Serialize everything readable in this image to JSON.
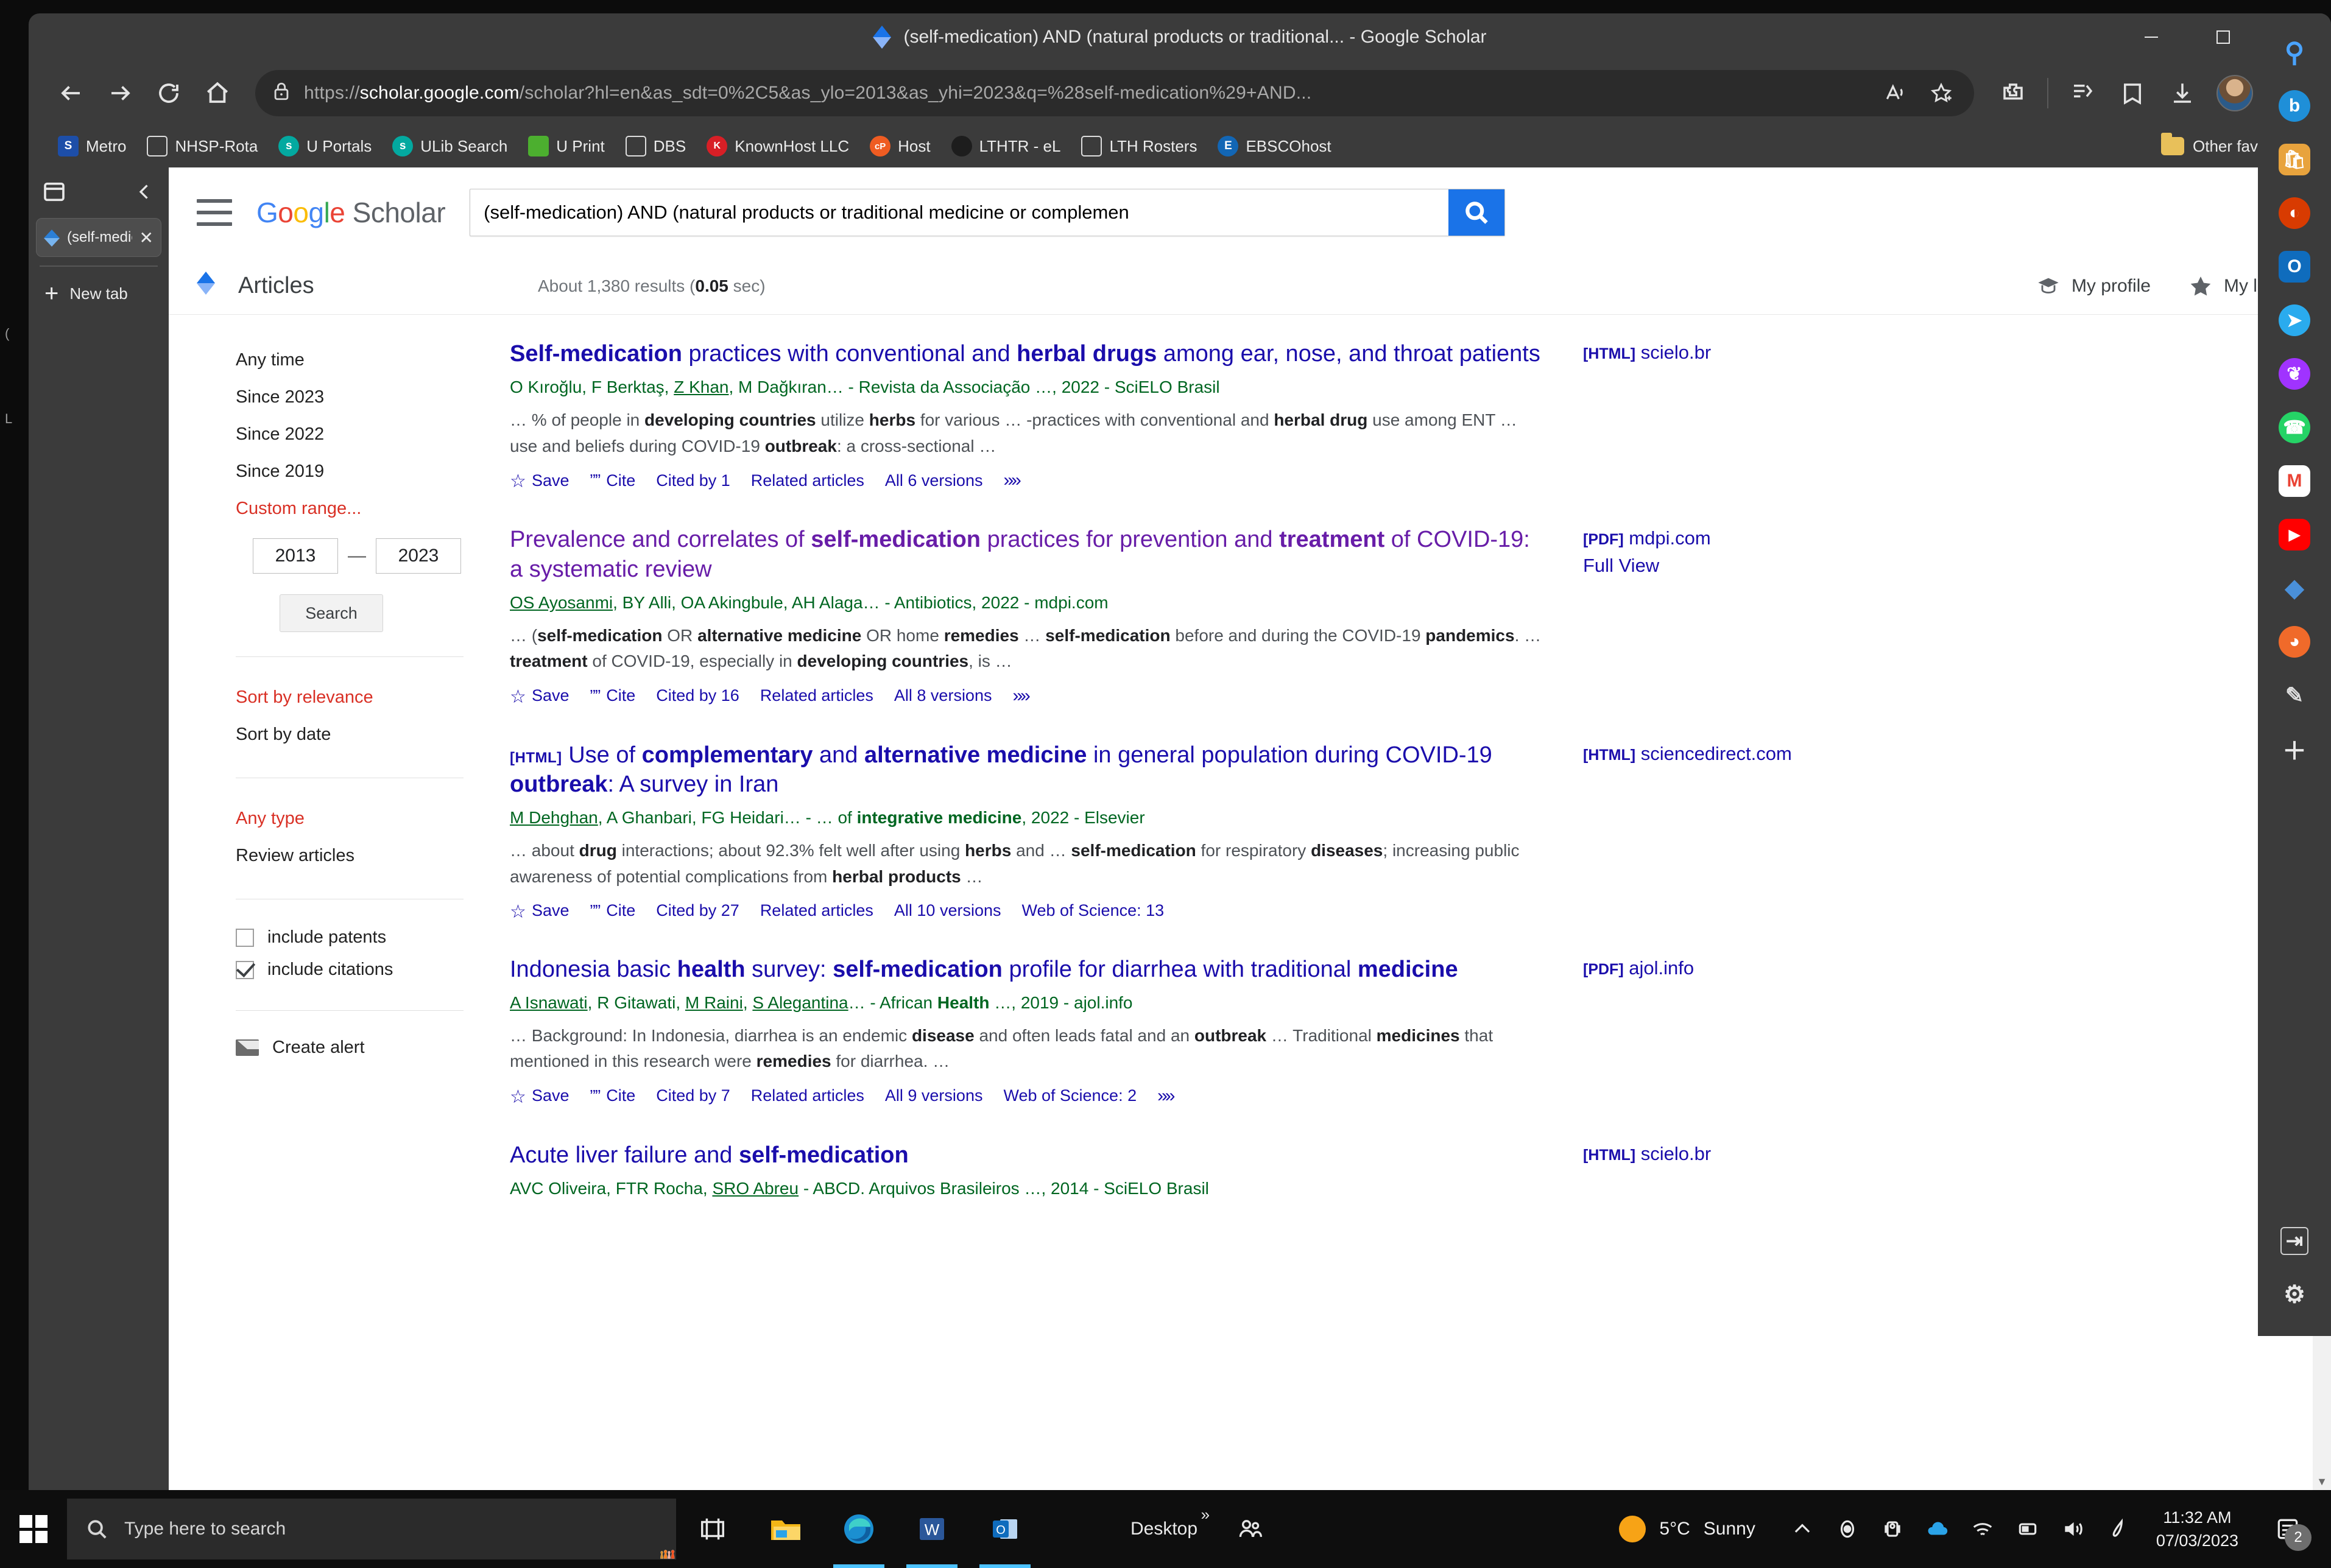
{
  "window": {
    "title": "(self-medication) AND (natural products or traditional... - Google Scholar",
    "minimize": "—",
    "maximize": "☐",
    "close": "✕"
  },
  "navbar": {
    "url_scheme": "https://",
    "url_host": "scholar.google.com",
    "url_path": "/scholar?hl=en&as_sdt=0%2C5&as_ylo=2013&as_yhi=2023&q=%28self-medication%29+AND...",
    "back_icon": "back-arrow-icon",
    "forward_icon": "forward-arrow-icon",
    "refresh_icon": "refresh-icon",
    "home_icon": "home-icon",
    "lock_icon": "lock-icon",
    "read_aloud_icon": "read-aloud-icon",
    "favorite_icon": "add-favorite-icon",
    "extensions_icon": "extensions-icon",
    "collections_icon": "collections-icon",
    "favorites_icon": "favorites-icon",
    "downloads_icon": "downloads-icon",
    "profile_icon": "profile-avatar",
    "settings_more": "•••"
  },
  "bookmarks": {
    "items": [
      {
        "label": "Metro",
        "icon": "metro-icon",
        "color": "#1d4ea8",
        "glyph": "S"
      },
      {
        "label": "NHSP-Rota",
        "icon": "page-icon",
        "color": "transparent",
        "glyph": ""
      },
      {
        "label": "U Portals",
        "icon": "sharepoint-icon",
        "color": "#03a9a0",
        "glyph": "s"
      },
      {
        "label": "ULib Search",
        "icon": "sharepoint-icon",
        "color": "#03a9a0",
        "glyph": "s"
      },
      {
        "label": "U Print",
        "icon": "papercut-icon",
        "color": "#4caf2f",
        "glyph": ""
      },
      {
        "label": "DBS",
        "icon": "page-icon",
        "color": "transparent",
        "glyph": ""
      },
      {
        "label": "KnownHost LLC",
        "icon": "knownhost-icon",
        "color": "#d81f26",
        "glyph": "K"
      },
      {
        "label": "Host",
        "icon": "cpanel-icon",
        "color": "#ef5c22",
        "glyph": "cP"
      },
      {
        "label": "LTHTR - eL",
        "icon": "dark-circle-icon",
        "color": "#2a2a2a",
        "glyph": ""
      },
      {
        "label": "LTH Rosters",
        "icon": "page-icon",
        "color": "transparent",
        "glyph": ""
      },
      {
        "label": "EBSCOhost",
        "icon": "ebsco-icon",
        "color": "#1266b5",
        "glyph": "E"
      }
    ],
    "other_favourites": "Other favourites",
    "other_favourites_icon": "folder-icon"
  },
  "tabstrip": {
    "toggle_icon": "tab-pane-icon",
    "collapse_icon": "chevron-left-icon",
    "tab_title": "(self-medicat",
    "tab_favicon": "google-scholar-icon",
    "tab_close": "✕",
    "new_tab": "New tab",
    "new_tab_icon": "plus-icon"
  },
  "scholar": {
    "menu_icon": "hamburger-menu-icon",
    "logo": {
      "g1": "G",
      "o1": "o",
      "o2": "o",
      "g2": "g",
      "l": "l",
      "e": "e",
      "scholar": "Scholar"
    },
    "search_value": "(self-medication) AND (natural products or traditional medicine or complemen",
    "search_placeholder": "Search",
    "search_button_icon": "search-icon",
    "account_avatar": "account-avatar",
    "articles_label": "Articles",
    "articles_icon": "google-scholar-diamond-icon",
    "results_text_prefix": "About 1,380 results (",
    "results_time": "0.05",
    "results_text_suffix": " sec)",
    "my_profile": "My profile",
    "my_profile_icon": "graduation-cap-icon",
    "my_library": "My library",
    "my_library_icon": "star-icon"
  },
  "sidebar": {
    "time_filters": [
      {
        "label": "Any time",
        "state": "normal"
      },
      {
        "label": "Since 2023",
        "state": "normal"
      },
      {
        "label": "Since 2022",
        "state": "normal"
      },
      {
        "label": "Since 2019",
        "state": "normal"
      },
      {
        "label": "Custom range...",
        "state": "active"
      }
    ],
    "year_from": "2013",
    "year_to": "2023",
    "range_dash": "—",
    "search_button": "Search",
    "sort_filters": [
      {
        "label": "Sort by relevance",
        "state": "active"
      },
      {
        "label": "Sort by date",
        "state": "normal"
      }
    ],
    "type_filters": [
      {
        "label": "Any type",
        "state": "active"
      },
      {
        "label": "Review articles",
        "state": "normal"
      }
    ],
    "checkboxes": [
      {
        "label": "include patents",
        "checked": false
      },
      {
        "label": "include citations",
        "checked": true
      }
    ],
    "create_alert": "Create alert",
    "create_alert_icon": "envelope-icon"
  },
  "results": [
    {
      "tag": "",
      "title_parts": [
        {
          "t": "Self-medication",
          "b": true
        },
        {
          "t": " practices with conventional and ",
          "b": false
        },
        {
          "t": "herbal drugs",
          "b": true
        },
        {
          "t": " among ear, nose, and throat patients",
          "b": false
        }
      ],
      "title_plain": "Self-medication practices with conventional and herbal drugs among ear, nose, and throat patients",
      "visited": false,
      "authors": "O Kıroğlu, F Brktaş, Z Khan, M Dağkıran… - Revista da Associação …, 2022 - SciELO Brasil",
      "authors_parts": [
        {
          "t": "O Kıroğlu, F Berktaş, ",
          "u": false,
          "b": false
        },
        {
          "t": "Z Khan",
          "u": true,
          "b": false
        },
        {
          "t": ", M Dağkıran… - Revista da Associação …, 2022 - SciELO Brasil",
          "u": false,
          "b": false
        }
      ],
      "snippet_parts": [
        {
          "t": "… % of people in ",
          "b": false
        },
        {
          "t": "developing countries",
          "b": true
        },
        {
          "t": " utilize ",
          "b": false
        },
        {
          "t": "herbs",
          "b": true
        },
        {
          "t": " for various … -practices with conventional and ",
          "b": false
        },
        {
          "t": "herbal drug",
          "b": true
        },
        {
          "t": " use among ENT … use and beliefs during COVID-19 ",
          "b": false
        },
        {
          "t": "outbreak",
          "b": true
        },
        {
          "t": ": a cross-sectional …",
          "b": false
        }
      ],
      "links": [
        "Save",
        "Cite",
        "Cited by 1",
        "Related articles",
        "All 6 versions"
      ],
      "has_more_chevron": true,
      "side_tag": "[HTML]",
      "side_domain": "scielo.br",
      "side_extra": ""
    },
    {
      "tag": "",
      "title_parts": [
        {
          "t": "Prevalence and correlates of ",
          "b": false
        },
        {
          "t": "self-medication",
          "b": true
        },
        {
          "t": " practices for prevention and ",
          "b": false
        },
        {
          "t": "treatment",
          "b": true
        },
        {
          "t": " of COVID-19: a systematic review",
          "b": false
        }
      ],
      "title_plain": "Prevalence and correlates of self-medication practices for prevention and treatment of COVID-19: a systematic review",
      "visited": true,
      "authors_parts": [
        {
          "t": "OS Ayosanmi",
          "u": true,
          "b": false
        },
        {
          "t": ", BY Alli, OA Akingbule, AH Alaga… - Antibiotics, 2022 - mdpi.com",
          "u": false,
          "b": false
        }
      ],
      "snippet_parts": [
        {
          "t": "… (",
          "b": false
        },
        {
          "t": "self-medication",
          "b": true
        },
        {
          "t": " OR ",
          "b": false
        },
        {
          "t": "alternative medicine",
          "b": true
        },
        {
          "t": " OR home ",
          "b": false
        },
        {
          "t": "remedies",
          "b": true
        },
        {
          "t": " … ",
          "b": false
        },
        {
          "t": "self-medication",
          "b": true
        },
        {
          "t": " before and during the COVID-19 ",
          "b": false
        },
        {
          "t": "pandemics",
          "b": true
        },
        {
          "t": ". … ",
          "b": false
        },
        {
          "t": "treatment",
          "b": true
        },
        {
          "t": " of COVID-19, especially in ",
          "b": false
        },
        {
          "t": "developing countries",
          "b": true
        },
        {
          "t": ", is …",
          "b": false
        }
      ],
      "links": [
        "Save",
        "Cite",
        "Cited by 16",
        "Related articles",
        "All 8 versions"
      ],
      "has_more_chevron": true,
      "side_tag": "[PDF]",
      "side_domain": "mdpi.com",
      "side_extra": "Full View"
    },
    {
      "tag": "[HTML]",
      "title_parts": [
        {
          "t": "Use of ",
          "b": false
        },
        {
          "t": "complementary",
          "b": true
        },
        {
          "t": " and ",
          "b": false
        },
        {
          "t": "alternative medicine",
          "b": true
        },
        {
          "t": " in general population during COVID-19 ",
          "b": false
        },
        {
          "t": "outbreak",
          "b": true
        },
        {
          "t": ": A survey in Iran",
          "b": false
        }
      ],
      "title_plain": "Use of complementary and alternative medicine in general population during COVID-19 outbreak: A survey in Iran",
      "visited": false,
      "authors_parts": [
        {
          "t": "M Dehghan",
          "u": true,
          "b": false
        },
        {
          "t": ", A Ghanbari, FG Heidari… - … of ",
          "u": false,
          "b": false
        },
        {
          "t": "integrative medicine",
          "u": false,
          "b": true
        },
        {
          "t": ", 2022 - Elsevier",
          "u": false,
          "b": false
        }
      ],
      "snippet_parts": [
        {
          "t": "… about ",
          "b": false
        },
        {
          "t": "drug",
          "b": true
        },
        {
          "t": " interactions; about 92.3% felt well after using ",
          "b": false
        },
        {
          "t": "herbs",
          "b": true
        },
        {
          "t": " and … ",
          "b": false
        },
        {
          "t": "self-medication",
          "b": true
        },
        {
          "t": " for respiratory ",
          "b": false
        },
        {
          "t": "diseases",
          "b": true
        },
        {
          "t": "; increasing public awareness of potential complications from ",
          "b": false
        },
        {
          "t": "herbal products",
          "b": true
        },
        {
          "t": " …",
          "b": false
        }
      ],
      "links": [
        "Save",
        "Cite",
        "Cited by 27",
        "Related articles",
        "All 10 versions",
        "Web of Science: 13"
      ],
      "has_more_chevron": false,
      "side_tag": "[HTML]",
      "side_domain": "sciencedirect.com",
      "side_extra": ""
    },
    {
      "tag": "",
      "title_parts": [
        {
          "t": "Indonesia basic ",
          "b": false
        },
        {
          "t": "health",
          "b": true
        },
        {
          "t": " survey: ",
          "b": false
        },
        {
          "t": "self-medication",
          "b": true
        },
        {
          "t": " profile for diarrhea with traditional ",
          "b": false
        },
        {
          "t": "medicine",
          "b": true
        }
      ],
      "title_plain": "Indonesia basic health survey: self-medication profile for diarrhea with traditional medicine",
      "visited": false,
      "authors_parts": [
        {
          "t": "A Isnawati",
          "u": true,
          "b": false
        },
        {
          "t": ", R Gitawati, ",
          "u": false,
          "b": false
        },
        {
          "t": "M Raini",
          "u": true,
          "b": false
        },
        {
          "t": ", ",
          "u": false,
          "b": false
        },
        {
          "t": "S Alegantina",
          "u": true,
          "b": false
        },
        {
          "t": "… - African ",
          "u": false,
          "b": false
        },
        {
          "t": "Health",
          "u": false,
          "b": true
        },
        {
          "t": " …, 2019 - ajol.info",
          "u": false,
          "b": false
        }
      ],
      "snippet_parts": [
        {
          "t": "… Background: In Indonesia, diarrhea is an endemic ",
          "b": false
        },
        {
          "t": "disease",
          "b": true
        },
        {
          "t": " and often leads fatal and an ",
          "b": false
        },
        {
          "t": "outbreak",
          "b": true
        },
        {
          "t": " … Traditional ",
          "b": false
        },
        {
          "t": "medicines",
          "b": true
        },
        {
          "t": " that mentioned in this research were ",
          "b": false
        },
        {
          "t": "remedies",
          "b": true
        },
        {
          "t": " for diarrhea. …",
          "b": false
        }
      ],
      "links": [
        "Save",
        "Cite",
        "Cited by 7",
        "Related articles",
        "All 9 versions",
        "Web of Science: 2"
      ],
      "has_more_chevron": true,
      "side_tag": "[PDF]",
      "side_domain": "ajol.info",
      "side_extra": ""
    },
    {
      "tag": "",
      "title_parts": [
        {
          "t": "Acute liver failure and ",
          "b": false
        },
        {
          "t": "self-medication",
          "b": true
        }
      ],
      "title_plain": "Acute liver failure and self-medication",
      "visited": false,
      "authors_parts": [
        {
          "t": "AVC Oliveira, FTR Rocha, ",
          "u": false,
          "b": false
        },
        {
          "t": "SRO Abreu",
          "u": true,
          "b": false
        },
        {
          "t": " - ABCD. Arquivos Brasileiros …, 2014 - SciELO Brasil",
          "u": false,
          "b": false
        }
      ],
      "snippet_parts": [],
      "links": [],
      "has_more_chevron": false,
      "side_tag": "[HTML]",
      "side_domain": "scielo.br",
      "side_extra": ""
    }
  ],
  "edge_sidebar": {
    "items": [
      {
        "name": "search-icon",
        "glyph": "⌕",
        "color": "#4aa3ff",
        "bg": "transparent"
      },
      {
        "name": "discover-icon",
        "glyph": "b",
        "color": "#ffffff",
        "bg": "#1f8fd8"
      },
      {
        "name": "shopping-icon",
        "glyph": "🛍",
        "color": "#ffffff",
        "bg": "#e8a33d"
      },
      {
        "name": "office-icon",
        "glyph": "◔",
        "color": "#ffffff",
        "bg": "#d83b01"
      },
      {
        "name": "outlook-icon",
        "glyph": "O",
        "color": "#ffffff",
        "bg": "#0f6cbd"
      },
      {
        "name": "telegram-icon",
        "glyph": "➤",
        "color": "#ffffff",
        "bg": "#2aabee"
      },
      {
        "name": "messenger-icon",
        "glyph": "❦",
        "color": "#ffffff",
        "bg": "#a033ff"
      },
      {
        "name": "whatsapp-icon",
        "glyph": "✆",
        "color": "#ffffff",
        "bg": "#25d366"
      },
      {
        "name": "gmail-icon",
        "glyph": "M",
        "color": "#ea4335",
        "bg": "#ffffff"
      },
      {
        "name": "youtube-icon",
        "glyph": "▶",
        "color": "#ffffff",
        "bg": "#ff0000"
      },
      {
        "name": "scholar-icon",
        "glyph": "◆",
        "color": "#ffffff",
        "bg": "#4a90d9"
      },
      {
        "name": "drop-icon",
        "glyph": "◕",
        "color": "#ffffff",
        "bg": "#f06a2a"
      },
      {
        "name": "tools-icon",
        "glyph": "✒",
        "color": "#dddddd",
        "bg": "transparent"
      },
      {
        "name": "add-icon",
        "glyph": "＋",
        "color": "#e8e8e8",
        "bg": "transparent"
      }
    ],
    "bottom_items": [
      {
        "name": "expand-panel-icon",
        "glyph": "⇥",
        "color": "#e8e8e8",
        "bg": "transparent"
      },
      {
        "name": "settings-gear-icon",
        "glyph": "⚙",
        "color": "#e8e8e8",
        "bg": "transparent"
      }
    ]
  },
  "taskbar": {
    "start_icon": "windows-start-icon",
    "search_placeholder": "Type here to search",
    "search_icon": "search-icon",
    "task_view_icon": "task-view-icon",
    "apps": [
      {
        "name": "file-explorer-icon",
        "active": false
      },
      {
        "name": "microsoft-edge-icon",
        "active": true
      },
      {
        "name": "microsoft-word-icon",
        "active": true
      },
      {
        "name": "microsoft-outlook-icon",
        "active": true
      }
    ],
    "desktop_label": "Desktop",
    "desktop_chevron": "»",
    "people_icon": "people-icon",
    "weather_temp": "5°C",
    "weather_desc": "Sunny",
    "weather_icon": "sun-icon",
    "tray": [
      {
        "name": "show-hidden-icons-chevron",
        "glyph": "∧"
      },
      {
        "name": "onedrive-sync-icon",
        "glyph": "◉"
      },
      {
        "name": "removable-media-icon",
        "glyph": "⎕"
      },
      {
        "name": "onedrive-cloud-icon",
        "glyph": "☁"
      },
      {
        "name": "wifi-icon",
        "glyph": "◠"
      },
      {
        "name": "battery-icon",
        "glyph": "▭"
      },
      {
        "name": "volume-icon",
        "glyph": "🔊"
      },
      {
        "name": "pen-icon",
        "glyph": "✐"
      }
    ],
    "clock_time": "11:32 AM",
    "clock_date": "07/03/2023",
    "notification_count": "2",
    "notification_icon": "action-center-icon"
  }
}
